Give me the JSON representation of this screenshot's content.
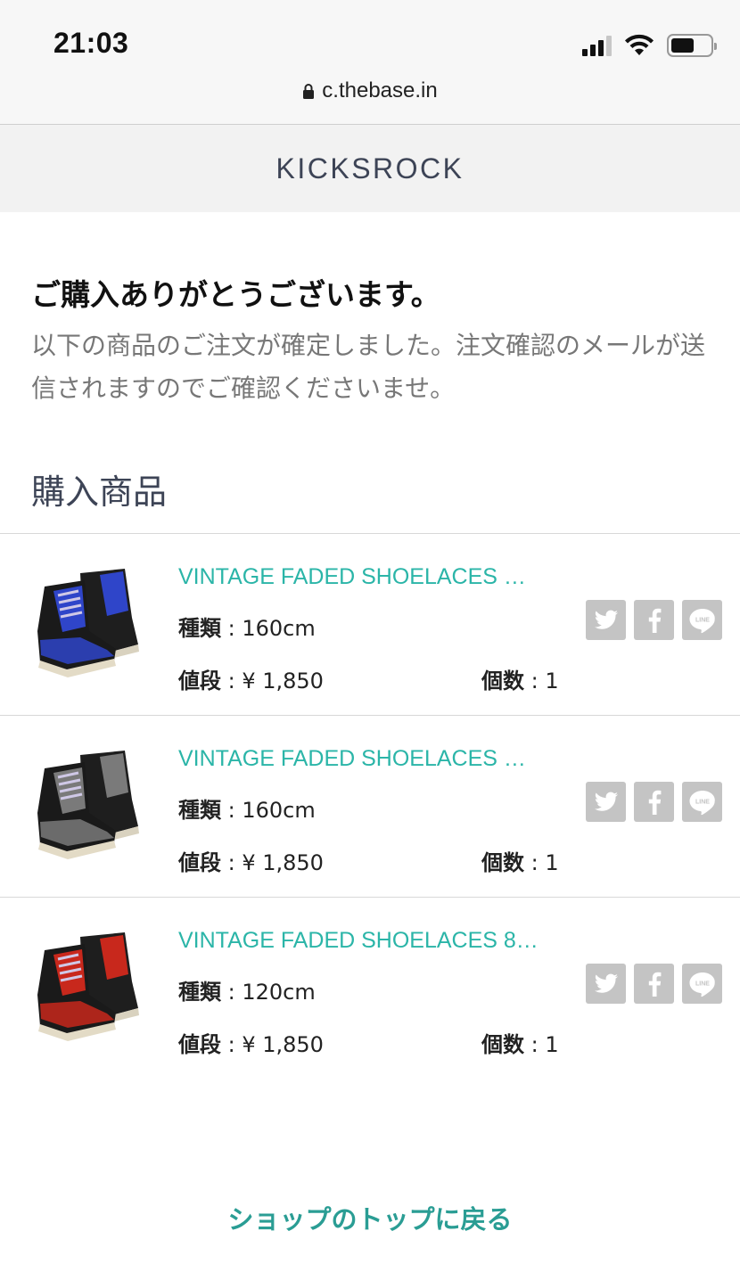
{
  "status_bar": {
    "time": "21:03"
  },
  "browser": {
    "url": "c.thebase.in"
  },
  "shop": {
    "name": "KICKSROCK"
  },
  "thanks": {
    "title": "ご購入ありがとうございます。",
    "message": "以下の商品のご注文が確定しました。注文確認のメールが送信されますのでご確認くださいませ。"
  },
  "section_title": "購入商品",
  "labels": {
    "variant": "種類",
    "price": "値段",
    "quantity": "個数",
    "separator": " : "
  },
  "items": [
    {
      "name": "VINTAGE FADED SHOELACES …",
      "variant": "160cm",
      "price": "¥ 1,850",
      "quantity": "1"
    },
    {
      "name": "VINTAGE FADED SHOELACES …",
      "variant": "160cm",
      "price": "¥ 1,850",
      "quantity": "1"
    },
    {
      "name": "VINTAGE FADED SHOELACES 8…",
      "variant": "120cm",
      "price": "¥ 1,850",
      "quantity": "1"
    }
  ],
  "shoe_colors": [
    "#2f45c9",
    "#7a7a7a",
    "#c8281c"
  ],
  "share_icons": [
    "twitter-icon",
    "facebook-icon",
    "line-icon"
  ],
  "back_link": "ショップのトップに戻る",
  "colors": {
    "accent": "#2bb5a8",
    "link": "#2a9d94",
    "header_text": "#3d4456",
    "share_bg": "#c4c4c4"
  }
}
